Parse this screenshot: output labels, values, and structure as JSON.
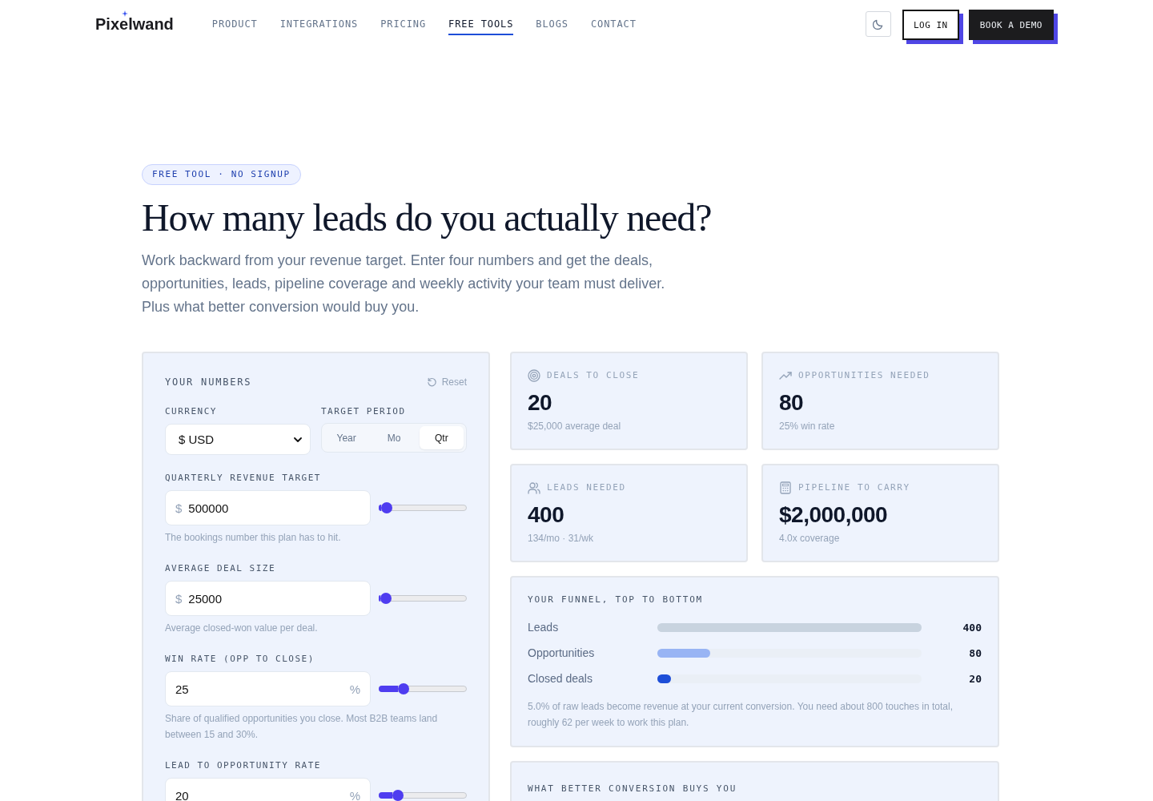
{
  "nav": {
    "logo": "Pixelwand",
    "links": [
      {
        "label": "PRODUCT",
        "selected": false
      },
      {
        "label": "INTEGRATIONS",
        "selected": false
      },
      {
        "label": "PRICING",
        "selected": false
      },
      {
        "label": "FREE TOOLS",
        "selected": true
      },
      {
        "label": "BLOGS",
        "selected": false
      },
      {
        "label": "CONTACT",
        "selected": false
      }
    ],
    "actions": [
      {
        "label": "LOG IN",
        "kind": "secondary"
      },
      {
        "label": "BOOK A DEMO",
        "kind": "primary"
      }
    ]
  },
  "hero": {
    "badge": "FREE TOOL · NO SIGNUP",
    "title": "How many leads do you actually need?",
    "intro": "Work backward from your revenue target. Enter four numbers and get the deals, opportunities, leads, pipeline coverage and weekly activity your team must deliver. Plus what better conversion would buy you."
  },
  "inputs": {
    "title": "YOUR NUMBERS",
    "reset": "Reset",
    "currency": {
      "label": "CURRENCY",
      "value": "$ USD"
    },
    "period": {
      "label": "TARGET PERIOD",
      "options": [
        {
          "label": "Year",
          "selected": false
        },
        {
          "label": "Mo",
          "selected": false
        },
        {
          "label": "Qtr",
          "selected": true
        }
      ]
    },
    "fields": [
      {
        "label": "QUARTERLY REVENUE TARGET",
        "prefix": "$",
        "value": "500000",
        "level": 0.03,
        "help": "The bookings number this plan has to hit."
      },
      {
        "label": "AVERAGE DEAL SIZE",
        "prefix": "$",
        "value": "25000",
        "level": 0.02,
        "help": "Average closed-won value per deal."
      },
      {
        "label": "WIN RATE (OPP TO CLOSE)",
        "suffix": "%",
        "value": "25",
        "level": 0.25,
        "help": "Share of qualified opportunities you close. Most B2B teams land between 15 and 30%."
      },
      {
        "label": "LEAD TO OPPORTUNITY RATE",
        "suffix": "%",
        "value": "20",
        "level": 0.18
      }
    ]
  },
  "results": {
    "metrics": [
      {
        "label": "DEALS TO CLOSE",
        "value": "20",
        "detail": "$25,000 average deal"
      },
      {
        "label": "OPPORTUNITIES NEEDED",
        "value": "80",
        "detail": "25% win rate"
      },
      {
        "label": "LEADS NEEDED",
        "value": "400",
        "detail": "134/mo · 31/wk"
      },
      {
        "label": "PIPELINE TO CARRY",
        "value": "$2,000,000",
        "detail": "4.0x coverage"
      }
    ],
    "funnel": {
      "title": "YOUR FUNNEL, TOP TO BOTTOM",
      "rows": [
        {
          "label": "Leads",
          "value": "400",
          "level": 1,
          "color": "#c8d3df"
        },
        {
          "label": "Opportunities",
          "value": "80",
          "level": 0.2,
          "color": "#98b4f4"
        },
        {
          "label": "Closed deals",
          "value": "20",
          "level": 0.05,
          "color": "#1d4ed8"
        }
      ],
      "note": "5.0% of raw leads become revenue at your current conversion. You need about 800 touches in total, roughly 62 per week to work this plan."
    },
    "upside": {
      "title": "WHAT BETTER CONVERSION BUYS YOU"
    }
  }
}
